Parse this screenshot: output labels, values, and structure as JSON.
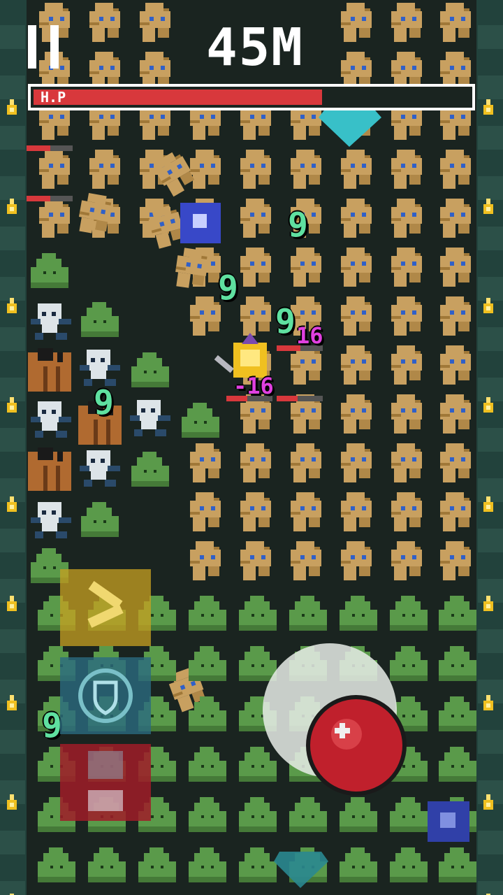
{
  "hud": {
    "distance": "45M",
    "hp_label": "H.P",
    "hp_fraction": 0.66,
    "pause_icon": "pause-icon"
  },
  "damage_numbers": [
    {
      "text": "9"
    },
    {
      "text": "9"
    },
    {
      "text": "9"
    },
    {
      "text": "16"
    },
    {
      "text": "-16"
    },
    {
      "text": "9"
    },
    {
      "text": "9"
    }
  ],
  "colors": {
    "hp": "#d8383c",
    "damage_text": "#5fe0a0",
    "crit_text": "#e040e0",
    "mummy": "#c8a060",
    "slime": "#5a9a4a",
    "wall": "#22423c",
    "attack_button": "#c0202c"
  },
  "skill_buttons": [
    {
      "name": "sword-skill-button",
      "icon": "swords-icon"
    },
    {
      "name": "shield-skill-button",
      "icon": "shield-icon"
    },
    {
      "name": "rage-skill-button",
      "icon": "fist-icon"
    }
  ],
  "attack_button": {
    "icon": "plus-icon"
  }
}
